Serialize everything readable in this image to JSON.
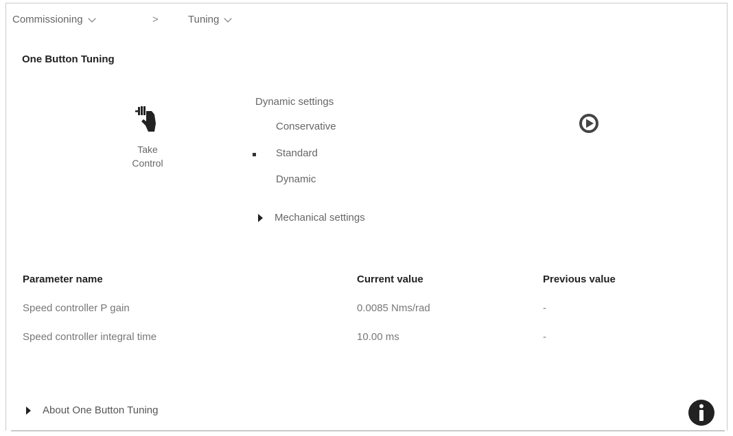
{
  "breadcrumb": {
    "commissioning_label": "Commissioning",
    "separator": ">",
    "tuning_label": "Tuning"
  },
  "page_title": "One Button Tuning",
  "take_control_label": "Take\nControl",
  "dynamic": {
    "title": "Dynamic settings",
    "options": [
      "Conservative",
      "Standard",
      "Dynamic"
    ],
    "selected": "Standard"
  },
  "mechanical_label": "Mechanical settings",
  "table": {
    "headers": [
      "Parameter name",
      "Current value",
      "Previous value"
    ],
    "rows": [
      [
        "Speed controller P gain",
        "0.0085 Nms/rad",
        "-"
      ],
      [
        "Speed controller integral time",
        "10.00 ms",
        "-"
      ]
    ]
  },
  "about_label": "About One Button Tuning",
  "icons": {
    "take_control": "hand-pointer-icon",
    "start": "play-circle-icon",
    "info": "info-circle-icon"
  }
}
